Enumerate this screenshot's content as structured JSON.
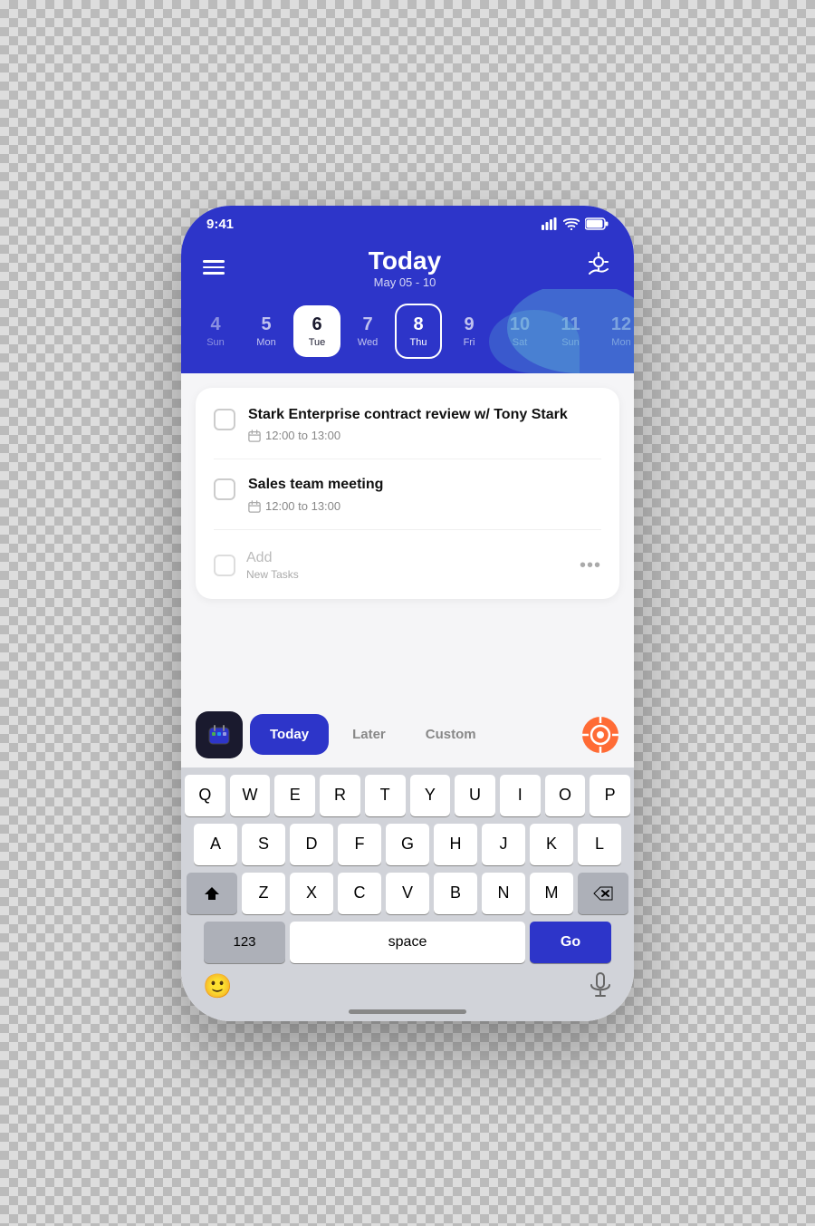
{
  "statusBar": {
    "time": "9:41",
    "signal": "●●●●",
    "wifi": "wifi",
    "battery": "battery"
  },
  "header": {
    "menuLabel": "menu",
    "title": "Today",
    "dateRange": "May 05 - 10",
    "sunIconLabel": "weather"
  },
  "calendar": {
    "days": [
      {
        "num": "4",
        "name": "Sun",
        "state": "faded"
      },
      {
        "num": "5",
        "name": "Mon",
        "state": "normal"
      },
      {
        "num": "6",
        "name": "Tue",
        "state": "selected"
      },
      {
        "num": "7",
        "name": "Wed",
        "state": "normal"
      },
      {
        "num": "8",
        "name": "Thu",
        "state": "highlighted"
      },
      {
        "num": "9",
        "name": "Fri",
        "state": "normal"
      },
      {
        "num": "10",
        "name": "Sat",
        "state": "faded"
      },
      {
        "num": "11",
        "name": "Sun",
        "state": "faded"
      },
      {
        "num": "12",
        "name": "Mon",
        "state": "faded"
      }
    ]
  },
  "tasks": [
    {
      "id": 1,
      "title": "Stark Enterprise contract review w/ Tony Stark",
      "time": "12:00 to 13:00",
      "checked": false
    },
    {
      "id": 2,
      "title": "Sales team meeting",
      "time": "12:00 to 13:00",
      "checked": false
    }
  ],
  "addTask": {
    "placeholder": "Add",
    "label": "New Tasks"
  },
  "quickBar": {
    "calendarIcon": "📅",
    "todayLabel": "Today",
    "laterLabel": "Later",
    "customLabel": "Custom"
  },
  "keyboard": {
    "rows": [
      [
        "Q",
        "W",
        "E",
        "R",
        "T",
        "Y",
        "U",
        "I",
        "O",
        "P"
      ],
      [
        "A",
        "S",
        "D",
        "F",
        "G",
        "H",
        "J",
        "K",
        "L"
      ],
      [
        "Z",
        "X",
        "C",
        "V",
        "B",
        "N",
        "M"
      ]
    ],
    "numLabel": "123",
    "spaceLabel": "space",
    "goLabel": "Go"
  }
}
